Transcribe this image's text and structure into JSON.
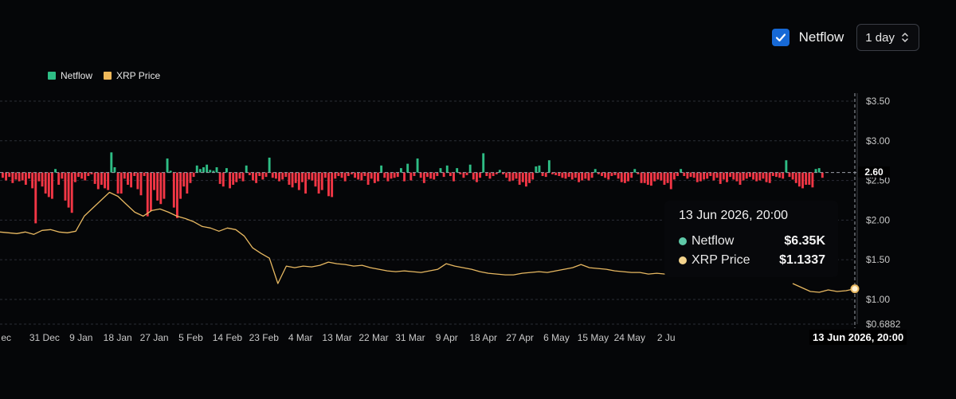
{
  "controls": {
    "netflow_label": "Netflow",
    "netflow_checked": true,
    "interval": "1 day"
  },
  "legend": [
    {
      "label": "Netflow",
      "color": "#2ebd85"
    },
    {
      "label": "XRP Price",
      "color": "#f0b95a"
    }
  ],
  "tooltip": {
    "date": "13 Jun 2026, 20:00",
    "rows": [
      {
        "name": "Netflow",
        "value": "$6.35K",
        "color": "#5fc9a8"
      },
      {
        "name": "XRP Price",
        "value": "$1.1337",
        "color": "#f3d38c"
      }
    ]
  },
  "crosshair": {
    "x_label": "13 Jun 2026, 20:00",
    "y_label": "2.60"
  },
  "chart_data": {
    "type": "bar",
    "colors": {
      "positive": "#2ebd85",
      "negative": "#f23645",
      "price": "#e7b861"
    },
    "x_ticks": [
      "ec",
      "31 Dec",
      "9 Jan",
      "18 Jan",
      "27 Jan",
      "5 Feb",
      "14 Feb",
      "23 Feb",
      "4 Mar",
      "13 Mar",
      "22 Mar",
      "31 Mar",
      "9 Apr",
      "18 Apr",
      "27 Apr",
      "6 May",
      "15 May",
      "24 May",
      "2 Ju"
    ],
    "y_axis": {
      "ticks": [
        "$3.50",
        "$3.00",
        "$2.50",
        "$2.00",
        "$1.50",
        "$1.00",
        "$0.6882"
      ],
      "tick_values": [
        3.5,
        3.0,
        2.5,
        2.0,
        1.5,
        1.0,
        0.6882
      ],
      "range": [
        0.6882,
        3.5
      ]
    },
    "netflow_baseline_price": 2.6,
    "netflow": [
      -0.3,
      -0.45,
      -0.25,
      -0.6,
      -0.4,
      -0.5,
      -0.45,
      -0.7,
      -0.35,
      -0.9,
      -2.9,
      -0.5,
      -0.8,
      -1.2,
      -1.4,
      -1.5,
      0.2,
      -0.7,
      -0.35,
      -1.6,
      -2.0,
      -2.3,
      -0.55,
      -0.25,
      -0.35,
      -0.45,
      -0.2,
      -0.1,
      -0.65,
      -0.95,
      -0.7,
      -0.9,
      -1.0,
      1.15,
      0.3,
      -1.2,
      -1.2,
      -0.35,
      -0.7,
      -0.85,
      -0.2,
      -0.95,
      -1.3,
      -0.2,
      -2.5,
      -2.2,
      -1.0,
      -1.6,
      -1.8,
      -1.5,
      0.8,
      0.1,
      -2.0,
      -2.6,
      -1.5,
      -0.8,
      -1.2,
      -0.6,
      -0.25,
      0.4,
      0.2,
      0.3,
      0.45,
      0.15,
      0.1,
      0.3,
      -0.65,
      -0.8,
      0.25,
      -0.9,
      -0.7,
      -0.55,
      -0.35,
      -0.5,
      0.4,
      -0.15,
      -0.45,
      -0.6,
      -0.2,
      -0.4,
      -0.25,
      0.85,
      -0.3,
      -0.35,
      -0.5,
      -0.4,
      -0.25,
      -0.7,
      -0.85,
      -0.6,
      -1.0,
      -0.55,
      -1.2,
      -0.4,
      -0.45,
      -0.8,
      -1.2,
      -1.0,
      -0.3,
      -1.35,
      -1.4,
      -0.35,
      -0.2,
      -0.3,
      -0.5,
      -0.2,
      -0.1,
      -0.3,
      -0.4,
      -0.45,
      -0.2,
      -0.7,
      -0.35,
      -0.6,
      -0.5,
      0.4,
      -0.3,
      -0.5,
      -0.35,
      -0.3,
      -0.25,
      0.25,
      -0.5,
      0.5,
      -0.45,
      -0.2,
      0.8,
      -0.3,
      -0.6,
      -0.25,
      -0.35,
      -0.4,
      -0.2,
      0.25,
      -0.25,
      0.4,
      -0.2,
      -0.5,
      0.25,
      -0.1,
      -0.3,
      -0.15,
      0.45,
      -0.4,
      -0.55,
      -0.3,
      1.1,
      -0.2,
      -0.35,
      -0.2,
      -0.1,
      0.15,
      -0.1,
      -0.3,
      -0.5,
      -0.45,
      -0.35,
      -0.7,
      -0.55,
      -0.8,
      -0.6,
      -0.4,
      0.35,
      0.4,
      -0.2,
      -0.25,
      0.7,
      -0.1,
      -0.15,
      -0.2,
      -0.3,
      -0.35,
      -0.25,
      -0.4,
      -0.3,
      -0.55,
      -0.45,
      -0.35,
      -0.45,
      -0.3,
      0.2,
      -0.1,
      -0.2,
      -0.3,
      -0.4,
      -0.2,
      -0.15,
      -0.35,
      -0.55,
      -0.6,
      -0.5,
      -0.3,
      0.2,
      -0.1,
      -0.6,
      -0.6,
      -0.7,
      -0.75,
      -0.5,
      -0.4,
      -0.45,
      -0.7,
      -0.6,
      -0.95,
      -0.4,
      -0.2,
      0.2,
      -0.2,
      -0.35,
      -0.25,
      -0.3,
      -0.55,
      -0.5,
      -0.4,
      -0.35,
      -0.2,
      -0.45,
      -0.3,
      -0.65,
      -0.4,
      -0.55,
      -0.25,
      -0.4,
      -0.5,
      -0.7,
      -0.45,
      -0.35,
      -0.25,
      -0.4,
      -0.5,
      -0.45,
      -0.35,
      -0.55,
      -0.6,
      -0.2,
      -0.25,
      -0.3,
      -0.35,
      0.7,
      -0.25,
      -0.4,
      -0.6,
      -0.8,
      -0.9,
      -0.7,
      -0.7,
      -0.85,
      0.2,
      0.25,
      -0.3
    ],
    "price": [
      [
        0,
        1.85
      ],
      [
        1,
        1.84
      ],
      [
        2,
        1.83
      ],
      [
        3,
        1.85
      ],
      [
        4,
        1.82
      ],
      [
        5,
        1.87
      ],
      [
        6,
        1.88
      ],
      [
        7,
        1.85
      ],
      [
        8,
        1.84
      ],
      [
        9,
        1.86
      ],
      [
        10,
        2.05
      ],
      [
        11,
        2.15
      ],
      [
        12,
        2.25
      ],
      [
        13,
        2.35
      ],
      [
        14,
        2.3
      ],
      [
        15,
        2.2
      ],
      [
        16,
        2.1
      ],
      [
        17,
        2.05
      ],
      [
        18,
        2.12
      ],
      [
        19,
        2.14
      ],
      [
        20,
        2.1
      ],
      [
        21,
        2.05
      ],
      [
        22,
        2.02
      ],
      [
        23,
        1.98
      ],
      [
        24,
        1.92
      ],
      [
        25,
        1.9
      ],
      [
        26,
        1.86
      ],
      [
        27,
        1.9
      ],
      [
        28,
        1.88
      ],
      [
        29,
        1.8
      ],
      [
        30,
        1.65
      ],
      [
        31,
        1.58
      ],
      [
        32,
        1.52
      ],
      [
        33,
        1.2
      ],
      [
        34,
        1.42
      ],
      [
        35,
        1.4
      ],
      [
        36,
        1.42
      ],
      [
        37,
        1.41
      ],
      [
        38,
        1.43
      ],
      [
        39,
        1.47
      ],
      [
        40,
        1.45
      ],
      [
        41,
        1.44
      ],
      [
        42,
        1.42
      ],
      [
        43,
        1.43
      ],
      [
        44,
        1.4
      ],
      [
        45,
        1.38
      ],
      [
        46,
        1.36
      ],
      [
        47,
        1.35
      ],
      [
        48,
        1.36
      ],
      [
        49,
        1.35
      ],
      [
        50,
        1.34
      ],
      [
        51,
        1.36
      ],
      [
        52,
        1.38
      ],
      [
        53,
        1.45
      ],
      [
        54,
        1.42
      ],
      [
        55,
        1.4
      ],
      [
        56,
        1.38
      ],
      [
        57,
        1.35
      ],
      [
        58,
        1.33
      ],
      [
        59,
        1.32
      ],
      [
        60,
        1.31
      ],
      [
        61,
        1.31
      ],
      [
        62,
        1.33
      ],
      [
        63,
        1.34
      ],
      [
        64,
        1.35
      ],
      [
        65,
        1.34
      ],
      [
        66,
        1.36
      ],
      [
        67,
        1.38
      ],
      [
        68,
        1.4
      ],
      [
        69,
        1.44
      ],
      [
        70,
        1.4
      ],
      [
        71,
        1.39
      ],
      [
        72,
        1.38
      ],
      [
        73,
        1.36
      ],
      [
        74,
        1.35
      ],
      [
        75,
        1.34
      ],
      [
        76,
        1.34
      ],
      [
        77,
        1.32
      ],
      [
        78,
        1.33
      ],
      [
        79,
        1.32
      ]
    ],
    "price_tail": [
      [
        0,
        1.2
      ],
      [
        1,
        1.15
      ],
      [
        2,
        1.1
      ],
      [
        3,
        1.09
      ],
      [
        4,
        1.12
      ],
      [
        5,
        1.1
      ],
      [
        6,
        1.11
      ],
      [
        7,
        1.1337
      ]
    ]
  }
}
